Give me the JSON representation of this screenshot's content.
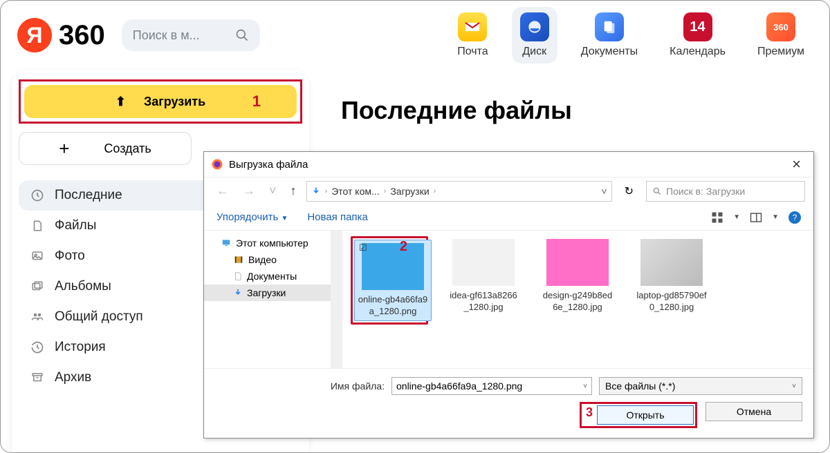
{
  "header": {
    "logo_letter": "Я",
    "logo_text": "360",
    "search_placeholder": "Поиск в м...",
    "apps": [
      {
        "label": "Почта",
        "color": "#ffcc00"
      },
      {
        "label": "Диск",
        "color": "#2e6be6"
      },
      {
        "label": "Документы",
        "color": "#2e86ff"
      },
      {
        "label": "Календарь",
        "badge": "14",
        "color": "#c8102e"
      },
      {
        "label": "Премиум",
        "color": "#ff5b2e"
      }
    ]
  },
  "sidebar": {
    "upload_label": "Загрузить",
    "create_label": "Создать",
    "items": [
      {
        "label": "Последние",
        "icon": "clock"
      },
      {
        "label": "Файлы",
        "icon": "file"
      },
      {
        "label": "Фото",
        "icon": "image"
      },
      {
        "label": "Альбомы",
        "icon": "albums"
      },
      {
        "label": "Общий доступ",
        "icon": "people"
      },
      {
        "label": "История",
        "icon": "history"
      },
      {
        "label": "Архив",
        "icon": "archive"
      }
    ]
  },
  "content": {
    "title": "Последние файлы"
  },
  "dialog": {
    "title": "Выгрузка файла",
    "breadcrumb": [
      "Этот ком...",
      "Загрузки"
    ],
    "search_placeholder": "Поиск в: Загрузки",
    "organize": "Упорядочить",
    "new_folder": "Новая папка",
    "tree": [
      {
        "label": "Этот компьютер",
        "icon": "pc"
      },
      {
        "label": "Видео",
        "icon": "video"
      },
      {
        "label": "Документы",
        "icon": "doc"
      },
      {
        "label": "Загрузки",
        "icon": "download",
        "selected": true
      }
    ],
    "files": [
      {
        "name": "online-gb4a66fa9a_1280.png",
        "selected": true
      },
      {
        "name": "idea-gf613a8266_1280.jpg"
      },
      {
        "name": "design-g249b8ed6e_1280.jpg"
      },
      {
        "name": "laptop-gd85790ef0_1280.jpg"
      }
    ],
    "filename_label": "Имя файла:",
    "filename_value": "online-gb4a66fa9a_1280.png",
    "filter": "Все файлы (*.*)",
    "open": "Открыть",
    "cancel": "Отмена"
  },
  "annotations": {
    "one": "1",
    "two": "2",
    "three": "3"
  }
}
